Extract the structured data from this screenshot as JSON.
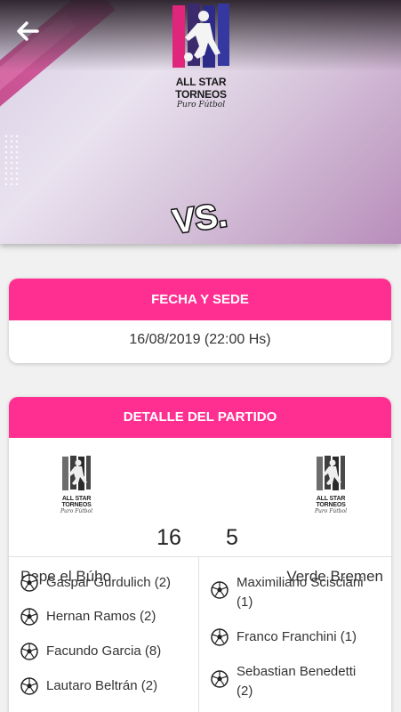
{
  "hero": {
    "brand": "ALL STAR TORNEOS",
    "tagline": "Puro Fútbol",
    "vs_label": "VS."
  },
  "fecha_card": {
    "title": "FECHA Y SEDE",
    "datetime": "16/08/2019 (22:00 Hs)"
  },
  "detalle_card": {
    "title": "DETALLE DEL PARTIDO",
    "home": {
      "name": "Pepe el Búho",
      "score": "16",
      "logo_brand": "ALL STAR TORNEOS",
      "logo_tagline": "Puro Fútbol",
      "scorers": [
        "Gaspar Gurdulich (2)",
        "Hernan Ramos (2)",
        "Facundo Garcia (8)",
        "Lautaro Beltrán (2)"
      ]
    },
    "away": {
      "name": "Verde Bremen",
      "score": "5",
      "logo_brand": "ALL STAR TORNEOS",
      "logo_tagline": "Puro Fútbol",
      "scorers": [
        {
          "line1": "Maximiliano Scisciani",
          "line2": "(1)"
        },
        {
          "line1": "Franco Franchini (1)",
          "line2": ""
        },
        {
          "line1": "Sebastian Benedetti",
          "line2": "(2)"
        }
      ]
    }
  },
  "colors": {
    "accent": "#ff2f92",
    "background": "#f1f1f1"
  },
  "icons": [
    "arrow-left-icon",
    "soccer-ball-icon"
  ]
}
